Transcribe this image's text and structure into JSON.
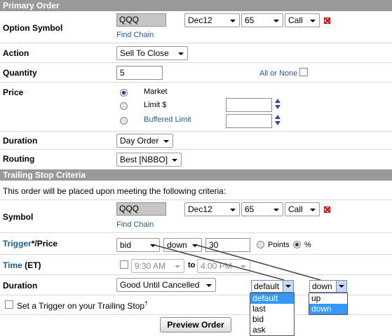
{
  "primary": {
    "header": "Primary Order",
    "option_symbol": {
      "label": "Option Symbol",
      "value": "QQQ",
      "find_chain": "Find Chain",
      "expiry": "Dec12",
      "strike": "65",
      "type": "Call"
    },
    "action": {
      "label": "Action",
      "value": "Sell To Close"
    },
    "quantity": {
      "label": "Quantity",
      "value": "5",
      "all_or_none": "All or None"
    },
    "price": {
      "label": "Price",
      "market": "Market",
      "limit": "Limit $",
      "buffered": "Buffered Limit"
    },
    "duration": {
      "label": "Duration",
      "value": "Day Order"
    },
    "routing": {
      "label": "Routing",
      "value": "Best [NBBO]"
    }
  },
  "trailing": {
    "header": "Trailing Stop Criteria",
    "note": "This order will be placed upon meeting the following criteria:",
    "symbol": {
      "label": "Symbol",
      "value": "QQQ",
      "find_chain": "Find Chain",
      "expiry": "Dec12",
      "strike": "65",
      "type": "Call"
    },
    "trigger": {
      "label_link": "Trigger",
      "label_rest": "*/Price",
      "field": "bid",
      "direction": "down",
      "value": "30",
      "points": "Points",
      "percent": "%"
    },
    "time": {
      "label_link": "Time",
      "label_rest": " (ET)",
      "start": "9:30 AM",
      "to": "to",
      "end": "4:00 PM"
    },
    "duration": {
      "label": "Duration",
      "value": "Good Until Cancelled"
    },
    "set_trigger": "Set a Trigger on your Trailing Stop",
    "dagger": "†"
  },
  "dropdowns": {
    "field": {
      "selected": "default",
      "options": [
        "default",
        "last",
        "bid",
        "ask"
      ]
    },
    "direction": {
      "selected": "down",
      "options": [
        "up",
        "down"
      ]
    }
  },
  "preview_button": "Preview Order",
  "colors": {
    "header_bg": "#999999",
    "link": "#1f5b9c",
    "highlight": "#3399ff"
  }
}
